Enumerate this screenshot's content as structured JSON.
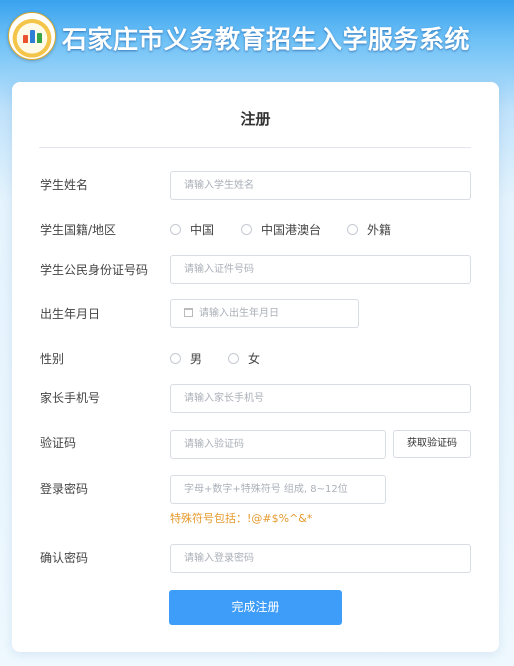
{
  "header": {
    "title": "石家庄市义务教育招生入学服务系统",
    "logo_icon": "school-emblem-icon"
  },
  "card": {
    "title": "注册",
    "fields": {
      "student_name": {
        "label": "学生姓名",
        "placeholder": "请输入学生姓名",
        "value": ""
      },
      "nationality": {
        "label": "学生国籍/地区",
        "options": [
          "中国",
          "中国港澳台",
          "外籍"
        ],
        "selected": ""
      },
      "id_number": {
        "label": "学生公民身份证号码",
        "placeholder": "请输入证件号码",
        "value": ""
      },
      "birth_date": {
        "label": "出生年月日",
        "placeholder": "请输入出生年月日",
        "icon": "calendar-icon",
        "value": ""
      },
      "gender": {
        "label": "性别",
        "options": [
          "男",
          "女"
        ],
        "selected": ""
      },
      "parent_phone": {
        "label": "家长手机号",
        "placeholder": "请输入家长手机号",
        "value": ""
      },
      "verification_code": {
        "label": "验证码",
        "placeholder": "请输入验证码",
        "button": "获取验证码",
        "value": ""
      },
      "password": {
        "label": "登录密码",
        "placeholder": "字母+数字+特殊符号 组成, 8~12位",
        "hint": "特殊符号包括：!@#$%^&*",
        "value": ""
      },
      "confirm_password": {
        "label": "确认密码",
        "placeholder": "请输入登录密码",
        "value": ""
      }
    },
    "submit": "完成注册"
  },
  "colors": {
    "primary_button": "#3f9dfa",
    "hint_text": "#e59a2e",
    "header_text": "#ffffff"
  }
}
